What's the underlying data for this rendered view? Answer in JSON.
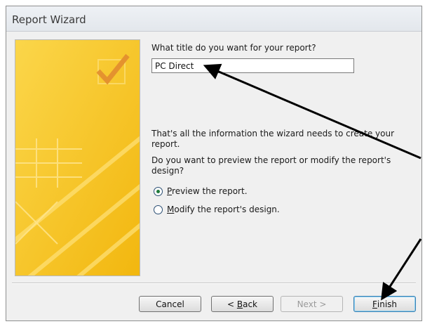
{
  "window": {
    "title": "Report Wizard"
  },
  "question": {
    "label": "What title do you want for your report?"
  },
  "title_field": {
    "value": "PC Direct"
  },
  "info": {
    "line1": "That's all the information the wizard needs to create your",
    "line2": "report.",
    "preview_q1": "Do you want to preview the report or modify the report's",
    "preview_q2": "design?"
  },
  "options": [
    {
      "mnemonic": "P",
      "rest": "review the report.",
      "selected": true
    },
    {
      "mnemonic": "M",
      "rest": "odify the report's design.",
      "selected": false
    }
  ],
  "buttons": {
    "cancel": "Cancel",
    "back_prefix": "< ",
    "back_mnemonic": "B",
    "back_rest": "ack",
    "next": "Next >",
    "finish_mnemonic": "F",
    "finish_rest": "inish"
  },
  "colors": {
    "graphic_yellow": "#f6c21c",
    "check_red": "#d5672f",
    "arrow": "#000000"
  }
}
